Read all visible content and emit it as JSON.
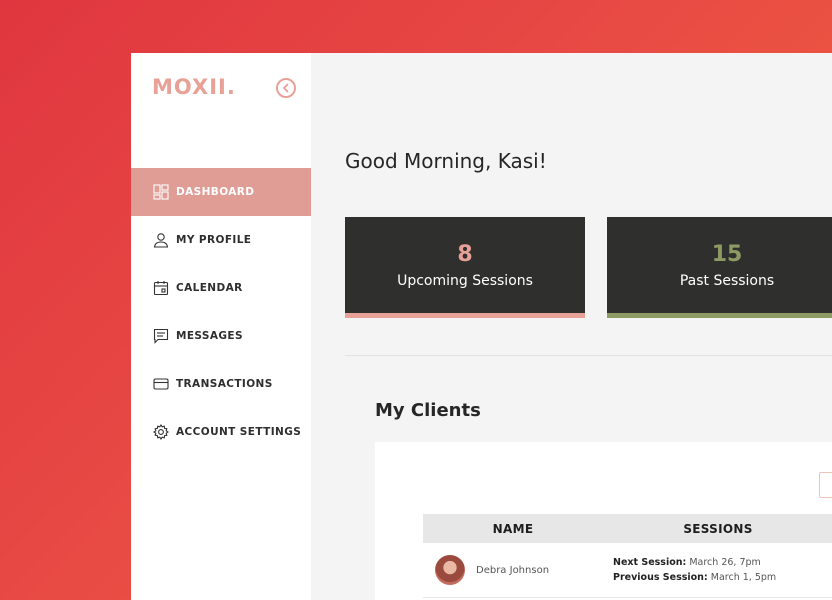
{
  "brand": {
    "logo": "MOXII."
  },
  "sidebar": {
    "items": [
      {
        "label": "DASHBOARD",
        "icon": "dashboard-icon",
        "active": true
      },
      {
        "label": "MY PROFILE",
        "icon": "user-icon",
        "active": false
      },
      {
        "label": "CALENDAR",
        "icon": "calendar-icon",
        "active": false
      },
      {
        "label": "MESSAGES",
        "icon": "chat-icon",
        "active": false
      },
      {
        "label": "TRANSACTIONS",
        "icon": "card-icon",
        "active": false
      },
      {
        "label": "ACCOUNT SETTINGS",
        "icon": "gear-icon",
        "active": false
      }
    ]
  },
  "main": {
    "greeting": "Good Morning, Kasi!",
    "stats": [
      {
        "value": "8",
        "label": "Upcoming Sessions",
        "color": "#e8a196"
      },
      {
        "value": "15",
        "label": "Past Sessions",
        "color": "#8e9a63"
      }
    ],
    "clients": {
      "title": "My Clients",
      "headers": {
        "name": "NAME",
        "sessions": "SESSIONS"
      },
      "rows": [
        {
          "name": "Debra Johnson",
          "next_label": "Next Session:",
          "next_value": "March 26, 7pm",
          "prev_label": "Previous Session:",
          "prev_value": "March 1, 5pm"
        }
      ]
    }
  },
  "colors": {
    "accent": "#e8a196",
    "active_nav": "#df9d96",
    "card_bg": "#2f302e",
    "past_accent": "#8e9a63"
  }
}
